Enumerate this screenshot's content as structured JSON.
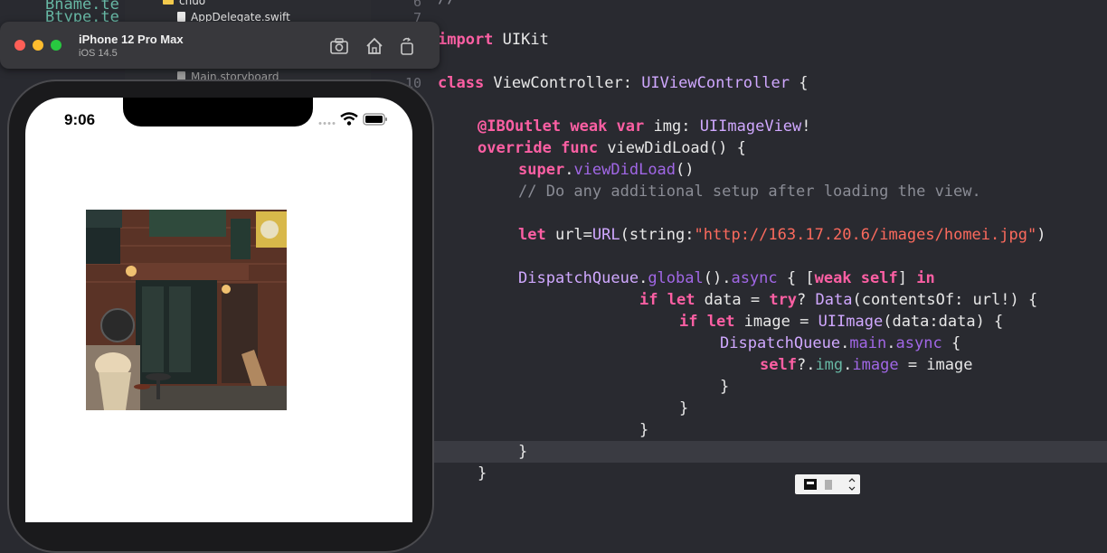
{
  "navigator": {
    "folder_label": "chuo",
    "items": [
      "AppDelegate.swift",
      "Main.storyboard"
    ]
  },
  "left_code": [
    "Bname.te",
    "Btype.te"
  ],
  "simulator": {
    "device_name": "iPhone 12 Pro Max",
    "os_version": "iOS 14.5",
    "status_time": "9:06",
    "buttons": [
      "screenshot-icon",
      "home-icon",
      "rotate-icon"
    ]
  },
  "editor": {
    "line_numbers": [
      "6",
      "7",
      "10"
    ],
    "lines": {
      "l0": "//",
      "l1_kw": "import",
      "l1_rest": " UIKit",
      "l2_kw": "class",
      "l2_name": " ViewController: ",
      "l2_type": "UIViewController",
      "l2_end": " {",
      "l3_attr": "@IBOutlet",
      "l3_kw1": " weak",
      "l3_kw2": " var",
      "l3_name": " img: ",
      "l3_type": "UIImageView",
      "l3_end": "!",
      "l4_kw1": "override",
      "l4_kw2": " func",
      "l4_rest": " viewDidLoad() {",
      "l5_kw": "super",
      "l5_dot": ".",
      "l5_mem": "viewDidLoad",
      "l5_end": "()",
      "l6_cmt": "// Do any additional setup after loading the view.",
      "l7_kw": "let",
      "l7_name": " url=",
      "l7_type": "URL",
      "l7_mid": "(string:",
      "l7_str": "\"http://163.17.20.6/images/homei.jpg\"",
      "l7_end": ")",
      "l8_type": "DispatchQueue",
      "l8_dot": ".",
      "l8_mem1": "global",
      "l8_mid": "().",
      "l8_mem2": "async",
      "l8_br": " { [",
      "l8_kw1": "weak",
      "l8_sp": " ",
      "l8_kw2": "self",
      "l8_br2": "] ",
      "l8_kw3": "in",
      "l9_kw1": "if",
      "l9_kw2": " let",
      "l9_name": " data = ",
      "l9_kw3": "try",
      "l9_q": "? ",
      "l9_type": "Data",
      "l9_end": "(contentsOf: url!) {",
      "l10_kw1": "if",
      "l10_kw2": " let",
      "l10_name": " image = ",
      "l10_type": "UIImage",
      "l10_end": "(data:data) {",
      "l11_type": "DispatchQueue",
      "l11_dot": ".",
      "l11_mem1": "main",
      "l11_dot2": ".",
      "l11_mem2": "async",
      "l11_end": " {",
      "l12_kw": "self",
      "l12_q": "?.",
      "l12_prop1": "img",
      "l12_dot": ".",
      "l12_prop2": "image",
      "l12_end": " = image",
      "l13": "}",
      "l14": "}",
      "l15": "}",
      "l16": "}",
      "l17": "}"
    }
  },
  "colors": {
    "editor_bg": "#292a30",
    "keyword": "#fc5fa3",
    "type": "#d0a8ff",
    "string": "#fc6a5d",
    "comment": "#8a8c95"
  }
}
